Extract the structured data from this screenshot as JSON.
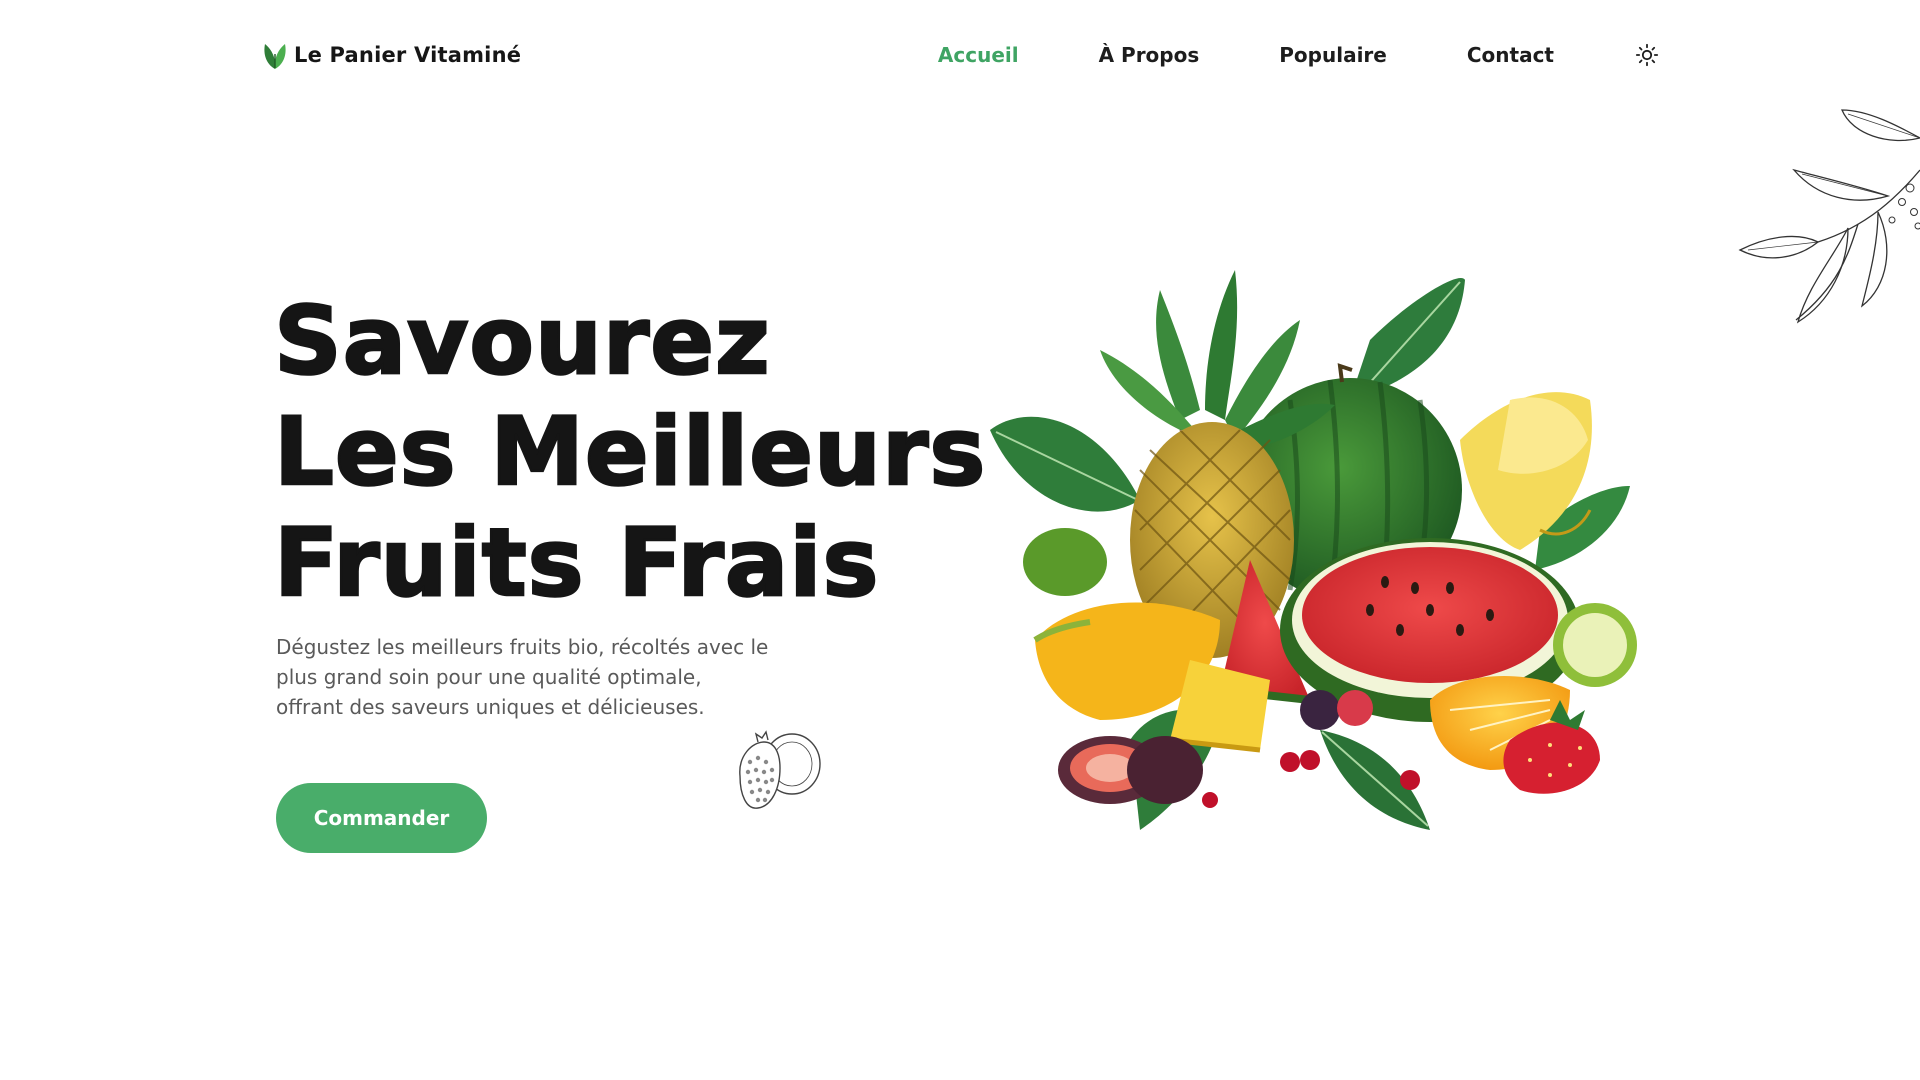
{
  "brand": {
    "name": "Le Panier Vitaminé",
    "icon": "leaf-icon"
  },
  "nav": {
    "items": [
      {
        "label": "Accueil",
        "active": true
      },
      {
        "label": "À Propos",
        "active": false
      },
      {
        "label": "Populaire",
        "active": false
      },
      {
        "label": "Contact",
        "active": false
      }
    ],
    "theme_icon": "sun-icon"
  },
  "hero": {
    "title_lines": [
      "Savourez",
      "Les Meilleurs",
      "Fruits Frais"
    ],
    "description_lines": [
      "Dégustez les meilleurs fruits bio, récoltés avec le",
      "plus grand soin pour une qualité optimale,",
      "offrant des saveurs uniques et délicieuses."
    ],
    "cta_label": "Commander"
  },
  "colors": {
    "accent": "#49ad6a",
    "accent_text": "#3fa463",
    "title": "#151515",
    "body_text": "#5a5a5a"
  },
  "decorations": {
    "hero_image": "fruit-basket-illustration",
    "sketch_1": "pomegranate-sketch",
    "sketch_2": "leafy-branch-sketch"
  }
}
